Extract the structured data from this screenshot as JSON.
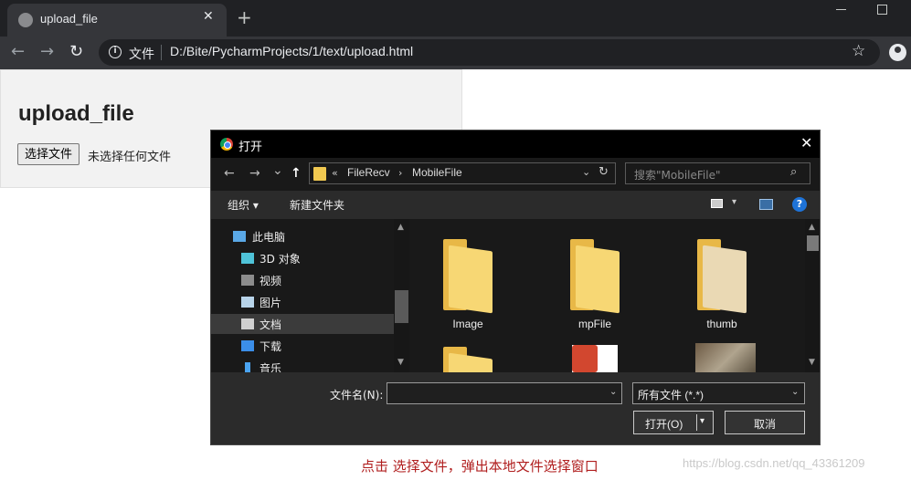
{
  "browser": {
    "tab_title": "upload_file",
    "tab_close": "✕",
    "new_tab": "+",
    "back": "←",
    "forward": "→",
    "reload": "↻",
    "info_glyph": "i",
    "file_tag": "文件",
    "url": "D:/Bite/PycharmProjects/1/text/upload.html",
    "star": "☆"
  },
  "page": {
    "heading": "upload_file",
    "choose_button": "选择文件",
    "no_file_text": "未选择任何文件"
  },
  "dialog": {
    "title": "打开",
    "close": "✕",
    "nav": {
      "back": "←",
      "forward": "→",
      "recent": "⌄",
      "up": "↑"
    },
    "path_prefix": "«",
    "path": [
      "FileRecv",
      "MobileFile"
    ],
    "path_sep": "›",
    "path_dropdown": "⌄",
    "refresh": "↻",
    "search_placeholder": "搜索\"MobileFile\"",
    "search_glyph": "⌕",
    "toolbar": {
      "organize": "组织 ▾",
      "new_folder": "新建文件夹",
      "view_dropdown": "▾",
      "help": "?"
    },
    "nav_items": [
      {
        "label": "此电脑",
        "icon": "computer-icon",
        "color": "#5aa8e6"
      },
      {
        "label": "3D 对象",
        "icon": "3d-objects-icon",
        "color": "#4fc3d8"
      },
      {
        "label": "视频",
        "icon": "video-icon",
        "color": "#8c8c8c"
      },
      {
        "label": "图片",
        "icon": "pictures-icon",
        "color": "#b8d4ea"
      },
      {
        "label": "文档",
        "icon": "documents-icon",
        "color": "#d0d0d0"
      },
      {
        "label": "下载",
        "icon": "downloads-icon",
        "color": "#3b8ee8"
      },
      {
        "label": "音乐",
        "icon": "music-icon",
        "color": "#4aa3f0"
      }
    ],
    "files": [
      "Image",
      "mpFile",
      "thumb",
      "",
      "",
      ""
    ],
    "filename_label": "文件名(N):",
    "filename_value": "",
    "filename_dropdown": "⌄",
    "filetype": "所有文件 (*.*)",
    "filetype_dropdown": "⌄",
    "open_button": "打开(O)",
    "open_dropdown": "▾",
    "cancel_button": "取消",
    "scroll_up": "▲",
    "scroll_down": "▼"
  },
  "caption": "点击 选择文件，弹出本地文件选择窗口",
  "watermark": "https://blog.csdn.net/qq_43361209"
}
